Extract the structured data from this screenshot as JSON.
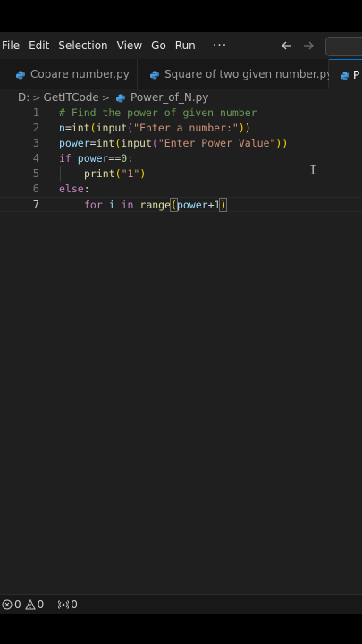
{
  "menubar": {
    "items": [
      "File",
      "Edit",
      "Selection",
      "View",
      "Go",
      "Run"
    ],
    "more": "···",
    "back_icon": "arrow-left-icon",
    "forward_icon": "arrow-right-icon"
  },
  "tabs": [
    {
      "label": "Copare number.py",
      "active": false
    },
    {
      "label": "Square of two given number.py",
      "active": false
    },
    {
      "label": "P",
      "active": true
    }
  ],
  "breadcrumb": {
    "drive": "D:",
    "folder": "GetITCode",
    "file": "Power_of_N.py"
  },
  "editor": {
    "line_numbers": [
      "1",
      "2",
      "3",
      "4",
      "5",
      "6",
      "7"
    ],
    "current_line": 7,
    "tokens": {
      "l1_comment": "# Find the power of given number",
      "l2_var": "n",
      "l2_eq": "=",
      "l2_fn1": "int",
      "l2_p1": "(",
      "l2_fn2": "input",
      "l2_p2": "(",
      "l2_str": "\"Enter a number:\"",
      "l2_p3": "))",
      "l3_var": "power",
      "l3_eq": "=",
      "l3_fn1": "int",
      "l3_p1": "(",
      "l3_fn2": "input",
      "l3_p2": "(",
      "l3_str": "\"Enter Power Value\"",
      "l3_p3": "))",
      "l4_kw": "if",
      "l4_var": "power",
      "l4_op": "==",
      "l4_num": "0",
      "l4_colon": ":",
      "l5_fn": "print",
      "l5_p1": "(",
      "l5_str": "\"1\"",
      "l5_p2": ")",
      "l6_kw": "else",
      "l6_colon": ":",
      "l7_kw1": "for",
      "l7_var": "i",
      "l7_kw2": "in",
      "l7_fn": "range",
      "l7_p1": "(",
      "l7_var2": "power",
      "l7_op": "+",
      "l7_num": "1",
      "l7_p2": ")"
    }
  },
  "statusbar": {
    "errors": "0",
    "warnings": "0",
    "ports": "0"
  },
  "colors": {
    "accent": "#0078d4",
    "editor_bg": "#1f1f1f",
    "python_icon": "#4aa0e6"
  }
}
